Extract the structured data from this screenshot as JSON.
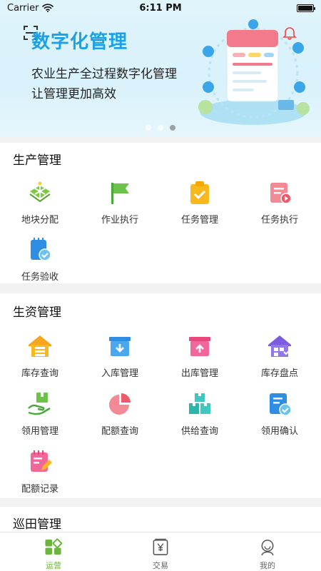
{
  "status_bar": {
    "carrier": "Carrier",
    "time": "6:11 PM"
  },
  "banner": {
    "title": "数字化管理",
    "subtitle_line1": "农业生产全过程数字化管理",
    "subtitle_line2": "让管理更加高效",
    "page_count": 3,
    "active_page": 3
  },
  "production": {
    "title": "生产管理",
    "items": [
      {
        "label": "地块分配",
        "icon": "field-grid-icon"
      },
      {
        "label": "作业执行",
        "icon": "flag-icon"
      },
      {
        "label": "任务管理",
        "icon": "clipboard-check-icon"
      },
      {
        "label": "任务执行",
        "icon": "play-document-icon"
      },
      {
        "label": "任务验收",
        "icon": "notebook-check-icon"
      }
    ]
  },
  "materials": {
    "title": "生资管理",
    "items": [
      {
        "label": "库存查询",
        "icon": "warehouse-icon"
      },
      {
        "label": "入库管理",
        "icon": "inbox-in-icon"
      },
      {
        "label": "出库管理",
        "icon": "box-out-icon"
      },
      {
        "label": "库存盘点",
        "icon": "house-grid-icon"
      },
      {
        "label": "领用管理",
        "icon": "hand-box-icon"
      },
      {
        "label": "配额查询",
        "icon": "pie-chart-icon"
      },
      {
        "label": "供给查询",
        "icon": "stacked-boxes-icon"
      },
      {
        "label": "领用确认",
        "icon": "document-check-icon"
      },
      {
        "label": "配额记录",
        "icon": "notepad-pen-icon"
      }
    ]
  },
  "patrol": {
    "title": "巡田管理"
  },
  "tabbar": {
    "items": [
      {
        "label": "运营",
        "icon": "grid-diamond-icon",
        "active": true
      },
      {
        "label": "交易",
        "icon": "yen-card-icon",
        "active": false
      },
      {
        "label": "我的",
        "icon": "person-icon",
        "active": false
      }
    ]
  },
  "colors": {
    "accent_blue": "#1da1e6",
    "active_tab": "#6cb33f"
  }
}
